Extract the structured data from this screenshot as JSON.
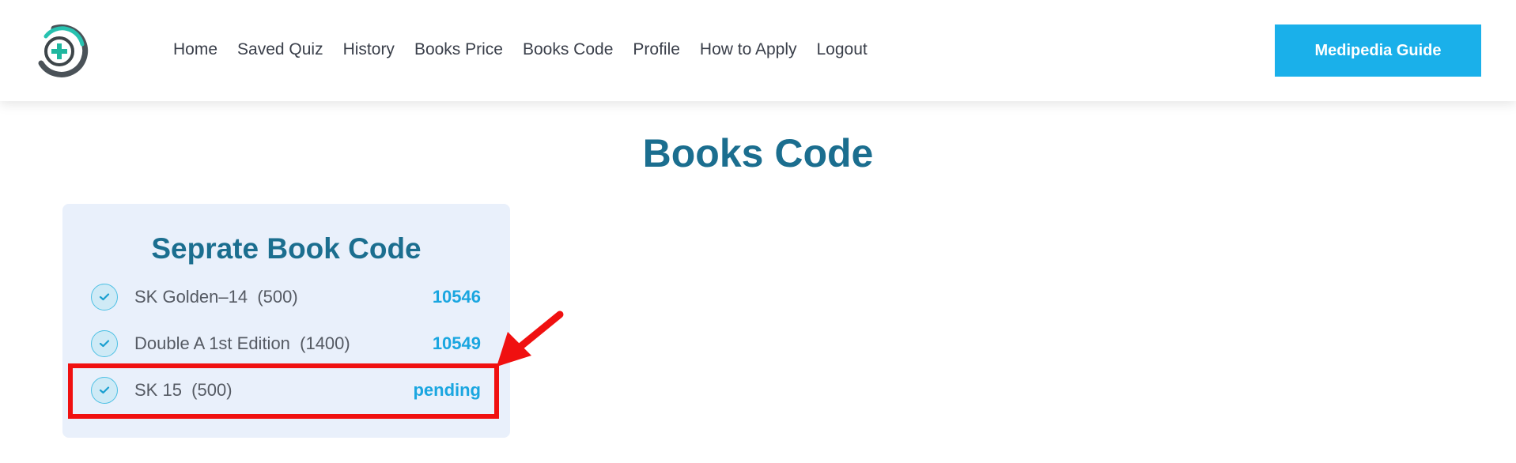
{
  "header": {
    "nav": [
      "Home",
      "Saved Quiz",
      "History",
      "Books Price",
      "Books Code",
      "Profile",
      "How to Apply",
      "Logout"
    ],
    "cta_label": "Medipedia Guide"
  },
  "page": {
    "title": "Books Code"
  },
  "card": {
    "title": "Seprate Book Code",
    "items": [
      {
        "label": "SK Golden–14  (500)",
        "code": "10546"
      },
      {
        "label": "Double A 1st Edition  (1400)",
        "code": "10549"
      },
      {
        "label": "SK 15  (500)",
        "code": "pending"
      }
    ]
  },
  "colors": {
    "accent": "#1ab0ea",
    "heading": "#1b6e8f",
    "highlight": "#f01010",
    "card_bg": "#e9f0fb"
  }
}
